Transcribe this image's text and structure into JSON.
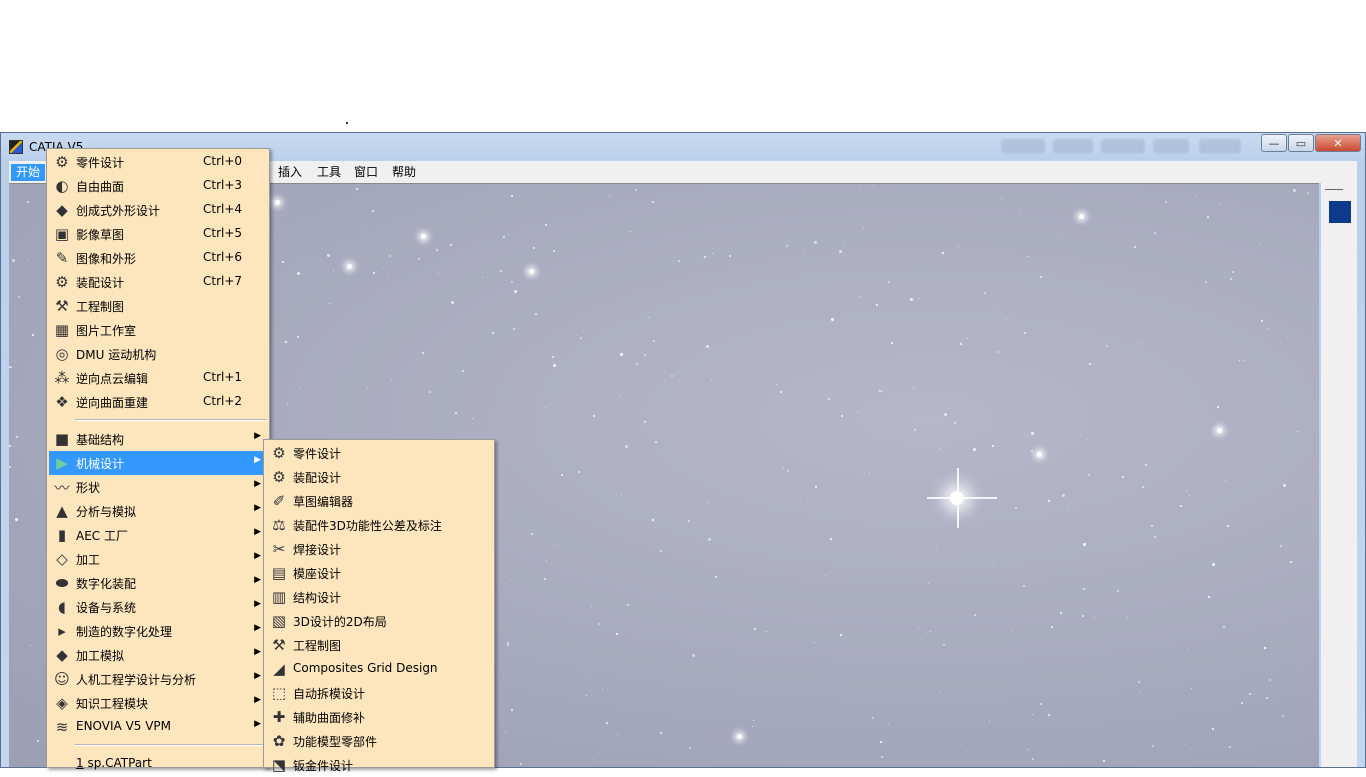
{
  "window": {
    "title": "CATIA V5"
  },
  "window_buttons": {
    "minimize": "—",
    "restore": "▭",
    "close": "✕"
  },
  "menubar": {
    "start": "开始",
    "insert": "插入",
    "tools": "工具",
    "window": "窗口",
    "help": "帮助"
  },
  "start_menu": {
    "workbenches": [
      {
        "label": "零件设计",
        "shortcut": "Ctrl+0",
        "icon": "gear-icon"
      },
      {
        "label": "自由曲面",
        "shortcut": "Ctrl+3",
        "icon": "freeform-surface-icon"
      },
      {
        "label": "创成式外形设计",
        "shortcut": "Ctrl+4",
        "icon": "generative-shape-icon"
      },
      {
        "label": "影像草图",
        "shortcut": "Ctrl+5",
        "icon": "image-sketch-icon"
      },
      {
        "label": "图像和外形",
        "shortcut": "Ctrl+6",
        "icon": "imagine-shape-icon"
      },
      {
        "label": "装配设计",
        "shortcut": "Ctrl+7",
        "icon": "assembly-gears-icon"
      },
      {
        "label": "工程制图",
        "shortcut": "",
        "icon": "drafting-icon"
      },
      {
        "label": "图片工作室",
        "shortcut": "",
        "icon": "photo-studio-icon"
      },
      {
        "label": "DMU 运动机构",
        "shortcut": "",
        "icon": "dmu-kinematics-icon"
      },
      {
        "label": "逆向点云编辑",
        "shortcut": "Ctrl+1",
        "icon": "point-cloud-icon"
      },
      {
        "label": "逆向曲面重建",
        "shortcut": "Ctrl+2",
        "icon": "surface-reconstruction-icon"
      }
    ],
    "categories": [
      {
        "label": "基础结构",
        "icon": "infrastructure-icon",
        "arrow": "▶"
      },
      {
        "label": "机械设计",
        "icon": "mechanical-design-icon",
        "arrow": "▶"
      },
      {
        "label": "形状",
        "icon": "shape-icon",
        "arrow": "▶"
      },
      {
        "label": "分析与模拟",
        "icon": "analysis-icon",
        "arrow": "▶"
      },
      {
        "label": "AEC 工厂",
        "icon": "aec-plant-icon",
        "arrow": "▶"
      },
      {
        "label": "加工",
        "icon": "machining-icon",
        "arrow": "▶"
      },
      {
        "label": "数字化装配",
        "icon": "digital-mockup-icon",
        "arrow": "▶"
      },
      {
        "label": "设备与系统",
        "icon": "equipment-systems-icon",
        "arrow": "▶"
      },
      {
        "label": "制造的数字化处理",
        "icon": "digital-process-icon",
        "arrow": "▶"
      },
      {
        "label": "加工模拟",
        "icon": "machining-simulation-icon",
        "arrow": "▶"
      },
      {
        "label": "人机工程学设计与分析",
        "icon": "ergonomics-icon",
        "arrow": "▶"
      },
      {
        "label": "知识工程模块",
        "icon": "knowledgeware-icon",
        "arrow": "▶"
      },
      {
        "label": "ENOVIA V5 VPM",
        "icon": "enovia-icon",
        "arrow": "▶"
      }
    ],
    "recent": {
      "number": "1",
      "file": " sp.CATPart"
    }
  },
  "mech_submenu": {
    "items": [
      {
        "label": "零件设计",
        "icon": "gear-icon"
      },
      {
        "label": "装配设计",
        "icon": "assembly-gears-icon"
      },
      {
        "label": "草图编辑器",
        "icon": "sketcher-icon"
      },
      {
        "label": "装配件3D功能性公差及标注",
        "icon": "tolerancing-icon"
      },
      {
        "label": "焊接设计",
        "icon": "weld-icon"
      },
      {
        "label": "模座设计",
        "icon": "mold-base-icon"
      },
      {
        "label": "结构设计",
        "icon": "structure-icon"
      },
      {
        "label": "3D设计的2D布局",
        "icon": "layout-2d-icon"
      },
      {
        "label": "工程制图",
        "icon": "drafting-icon"
      },
      {
        "label": "Composites Grid Design",
        "icon": "composites-icon"
      },
      {
        "label": "自动拆模设计",
        "icon": "core-cavity-icon"
      },
      {
        "label": "辅助曲面修补",
        "icon": "healing-icon"
      },
      {
        "label": "功能模型零部件",
        "icon": "functional-molded-icon"
      },
      {
        "label": "钣金件设计",
        "icon": "sheet-metal-icon"
      }
    ]
  },
  "colors": {
    "menu_bg": "#fde6be",
    "highlight": "#3399ff",
    "viewport_bg": "#a6a8bd",
    "side_square": "#0e3a8a"
  }
}
